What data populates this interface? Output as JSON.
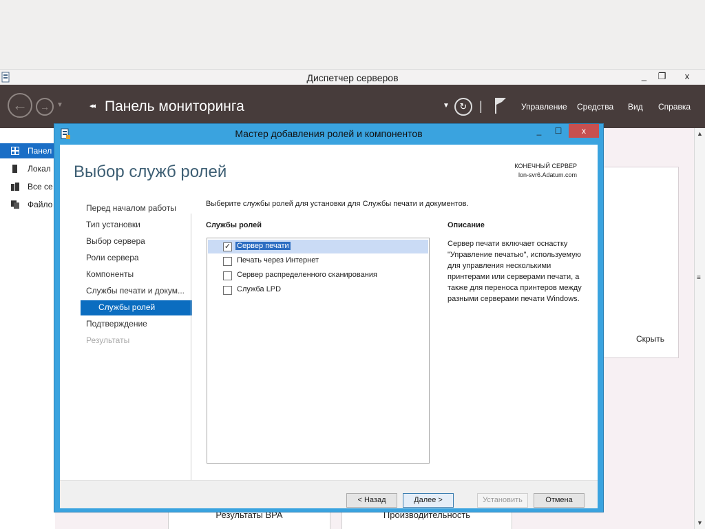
{
  "server_manager": {
    "title": "Диспетчер серверов",
    "window_buttons": [
      "_",
      "❐",
      "x"
    ],
    "breadcrumb_arrows": "◂◂",
    "breadcrumb": "Панель мониторинга",
    "separator": "|",
    "menu": [
      "Управление",
      "Средства",
      "Вид",
      "Справка"
    ],
    "sidebar": [
      {
        "label": "Панел",
        "icon": "dashboard-icon",
        "active": true
      },
      {
        "label": "Локал",
        "icon": "local-server-icon"
      },
      {
        "label": "Все се",
        "icon": "all-servers-icon"
      },
      {
        "label": "Файло",
        "icon": "file-services-icon"
      }
    ],
    "hide_link": "Скрыть",
    "bottom_tiles": [
      "Результаты BPA",
      "Производительность"
    ]
  },
  "wizard": {
    "title": "Мастер добавления ролей и компонентов",
    "heading": "Выбор служб ролей",
    "destination_label": "КОНЕЧНЫЙ СЕРВЕР",
    "destination_value": "lon-svr6.Adatum.com",
    "nav": [
      {
        "label": "Перед началом работы"
      },
      {
        "label": "Тип установки"
      },
      {
        "label": "Выбор сервера"
      },
      {
        "label": "Роли сервера"
      },
      {
        "label": "Компоненты"
      },
      {
        "label": "Службы печати и докум..."
      },
      {
        "label": "Службы ролей"
      },
      {
        "label": "Подтверждение"
      },
      {
        "label": "Результаты"
      }
    ],
    "instruction": "Выберите службы ролей для установки для Службы печати и документов.",
    "roles_header": "Службы ролей",
    "roles": [
      {
        "label": "Сервер печати",
        "checked": true
      },
      {
        "label": "Печать через Интернет",
        "checked": false
      },
      {
        "label": "Сервер распределенного сканирования",
        "checked": false
      },
      {
        "label": "Служба LPD",
        "checked": false
      }
    ],
    "description_header": "Описание",
    "description": "Сервер печати включает оснастку \"Управление печатью\", используемую для управления несколькими принтерами или серверами печати, а также для переноса принтеров между разными серверами печати Windows.",
    "buttons": {
      "back": "< Назад",
      "next": "Далее >",
      "install": "Установить",
      "cancel": "Отмена"
    },
    "window_buttons": {
      "minimize": "_",
      "maximize": "☐",
      "close": "x"
    },
    "colors": {
      "accent": "#3aa3df",
      "nav_active": "#0b6dc0",
      "close": "#c75050"
    }
  }
}
